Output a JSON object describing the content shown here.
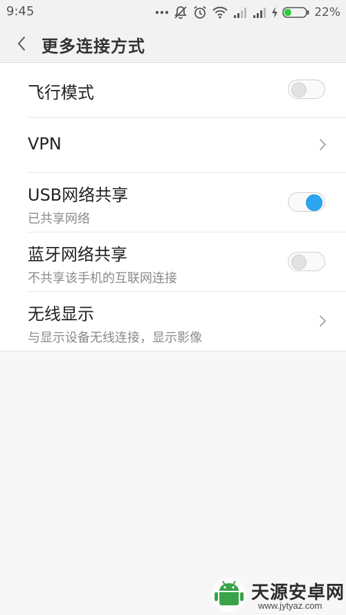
{
  "status_bar": {
    "time": "9:45",
    "icons": [
      "more-dots-icon",
      "notifications-muted-icon",
      "alarm-icon",
      "wifi-icon",
      "signal-1-icon",
      "signal-2-icon",
      "charging-icon",
      "battery-icon"
    ],
    "battery_percent": "22%",
    "battery_level": 0.22,
    "battery_color": "#2ecc40"
  },
  "header": {
    "title": "更多连接方式",
    "back_icon": "chevron-left-icon"
  },
  "settings": {
    "accent_color": "#2da6f2",
    "items": [
      {
        "title": "飞行模式",
        "control": "toggle",
        "on": false
      },
      {
        "title": "VPN",
        "control": "chevron-right-icon"
      },
      {
        "title": "USB网络共享",
        "subtitle": "已共享网络",
        "control": "toggle",
        "on": true
      },
      {
        "title": "蓝牙网络共享",
        "subtitle": "不共享该手机的互联网连接",
        "control": "toggle",
        "on": false
      },
      {
        "title": "无线显示",
        "subtitle": "与显示设备无线连接，显示影像",
        "control": "chevron-right-icon"
      }
    ]
  },
  "watermark": {
    "text": "天源安卓网",
    "url": "www.jytyaz.com"
  }
}
